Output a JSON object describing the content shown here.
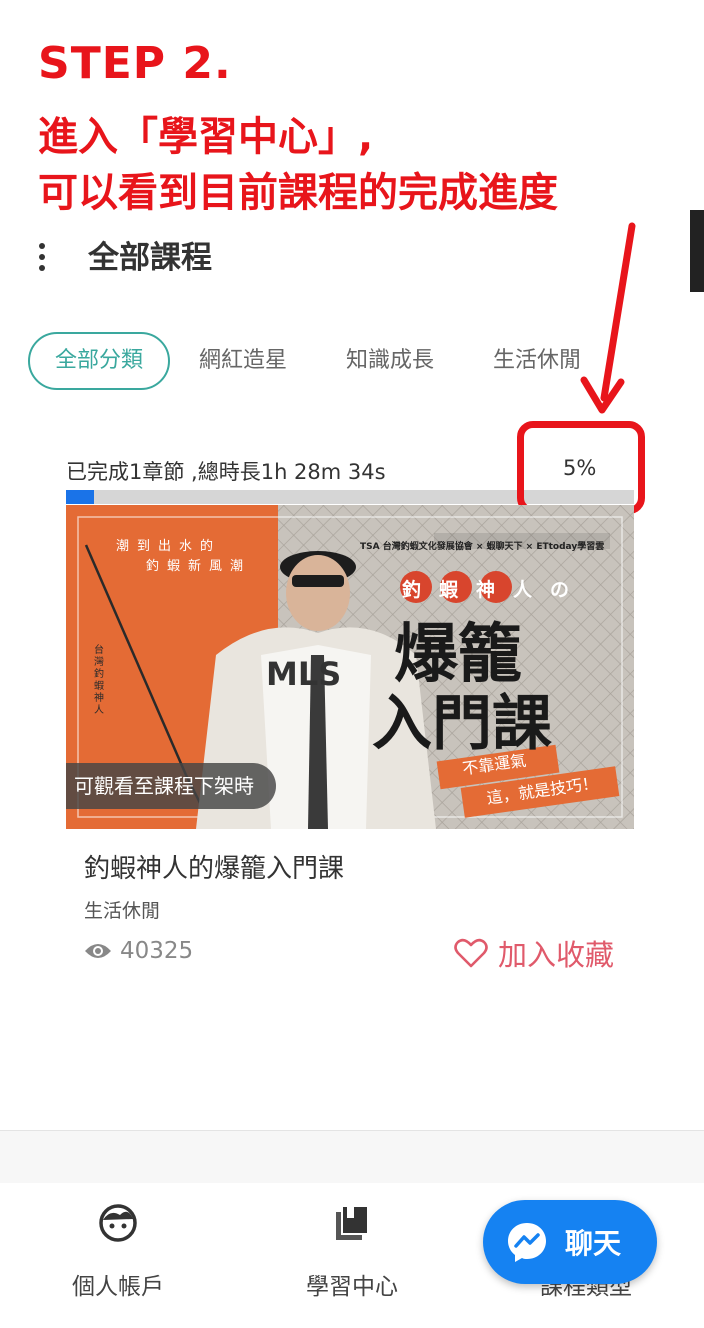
{
  "annotation": {
    "step": "STEP 2.",
    "line1": "進入「學習中心」,",
    "line2": "可以看到目前課程的完成進度",
    "color": "#e8151b"
  },
  "header": {
    "title": "全部課程",
    "menu_icon": "more-vertical-icon"
  },
  "tabs": [
    {
      "label": "全部分類",
      "active": true
    },
    {
      "label": "網紅造星",
      "active": false
    },
    {
      "label": "知識成長",
      "active": false
    },
    {
      "label": "生活休閒",
      "active": false
    }
  ],
  "course": {
    "progress_text": "已完成1章節 ,總時長1h 28m 34s",
    "progress_percent_label": "5%",
    "progress_value": 0.05,
    "image": {
      "top_caption_1": "潮到出水的",
      "top_caption_2": "釣蝦新風潮",
      "logos": "TSA 台灣釣蝦文化發展協會 × 蝦聊天下 × ETtoday學習雲",
      "subtitle": "釣蝦神人の",
      "headline_1": "爆籠",
      "headline_2": "入門課",
      "vertical_name": "台灣釣蝦神人",
      "shirt_text": "MLS",
      "tagline_1": "不靠運氣",
      "tagline_2": "這，就是技巧！",
      "availability_badge": "可觀看至課程下架時"
    },
    "title": "釣蝦神人的爆籠入門課",
    "category": "生活休閒",
    "views": "40325",
    "favorite_label": "加入收藏"
  },
  "bottom_nav": [
    {
      "label": "個人帳戶",
      "icon": "user-face-icon"
    },
    {
      "label": "學習中心",
      "icon": "books-icon"
    },
    {
      "label": "課程類型",
      "icon": "category-icon"
    }
  ],
  "chat": {
    "label": "聊天",
    "icon": "messenger-icon",
    "color": "#1582f2"
  },
  "colors": {
    "accent": "#3aa89e",
    "progress": "#1a73e8",
    "favorite": "#e05a6b",
    "image_orange": "#e46b35"
  }
}
